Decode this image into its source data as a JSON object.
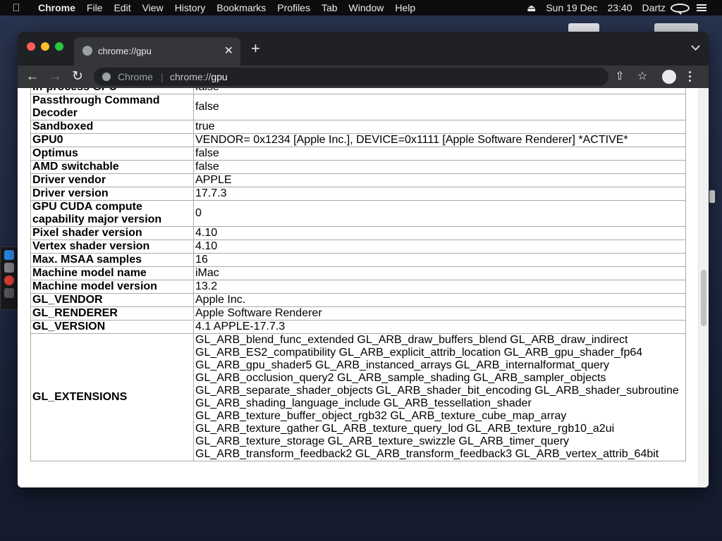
{
  "menubar": {
    "app": "Chrome",
    "items": [
      "File",
      "Edit",
      "View",
      "History",
      "Bookmarks",
      "Profiles",
      "Tab",
      "Window",
      "Help"
    ],
    "date": "Sun 19 Dec",
    "time": "23:40",
    "user": "Dartz"
  },
  "browser": {
    "tab_title": "chrome://gpu",
    "omnibox_label": "Chrome",
    "omnibox_sep": "|",
    "url_scheme": "chrome://",
    "url_host": "gpu"
  },
  "gpu_rows": [
    {
      "key": "In-process GPU",
      "value": "false"
    },
    {
      "key": "Passthrough Command Decoder",
      "value": "false"
    },
    {
      "key": "Sandboxed",
      "value": "true"
    },
    {
      "key": "GPU0",
      "value": "VENDOR= 0x1234 [Apple Inc.], DEVICE=0x1111 [Apple Software Renderer] *ACTIVE*"
    },
    {
      "key": "Optimus",
      "value": "false"
    },
    {
      "key": "AMD switchable",
      "value": "false"
    },
    {
      "key": "Driver vendor",
      "value": "APPLE"
    },
    {
      "key": "Driver version",
      "value": "17.7.3"
    },
    {
      "key": "GPU CUDA compute capability major version",
      "value": "0"
    },
    {
      "key": "Pixel shader version",
      "value": "4.10"
    },
    {
      "key": "Vertex shader version",
      "value": "4.10"
    },
    {
      "key": "Max. MSAA samples",
      "value": "16"
    },
    {
      "key": "Machine model name",
      "value": "iMac"
    },
    {
      "key": "Machine model version",
      "value": "13.2"
    },
    {
      "key": "GL_VENDOR",
      "value": "Apple Inc."
    },
    {
      "key": "GL_RENDERER",
      "value": "Apple Software Renderer"
    },
    {
      "key": "GL_VERSION",
      "value": "4.1 APPLE-17.7.3"
    }
  ],
  "gl_extensions": {
    "key": "GL_EXTENSIONS",
    "lines": [
      "GL_ARB_blend_func_extended GL_ARB_draw_buffers_blend GL_ARB_draw_indirect",
      "GL_ARB_ES2_compatibility GL_ARB_explicit_attrib_location GL_ARB_gpu_shader_fp64",
      "GL_ARB_gpu_shader5 GL_ARB_instanced_arrays GL_ARB_internalformat_query",
      "GL_ARB_occlusion_query2 GL_ARB_sample_shading GL_ARB_sampler_objects",
      "GL_ARB_separate_shader_objects GL_ARB_shader_bit_encoding GL_ARB_shader_subroutine",
      "GL_ARB_shading_language_include GL_ARB_tessellation_shader",
      "GL_ARB_texture_buffer_object_rgb32 GL_ARB_texture_cube_map_array",
      "GL_ARB_texture_gather GL_ARB_texture_query_lod GL_ARB_texture_rgb10_a2ui",
      "GL_ARB_texture_storage GL_ARB_texture_swizzle GL_ARB_timer_query",
      "GL_ARB_transform_feedback2 GL_ARB_transform_feedback3 GL_ARB_vertex_attrib_64bit"
    ]
  },
  "colors": {
    "traffic_close": "#ff5f57",
    "traffic_min": "#febc2e",
    "traffic_max": "#28c840"
  }
}
